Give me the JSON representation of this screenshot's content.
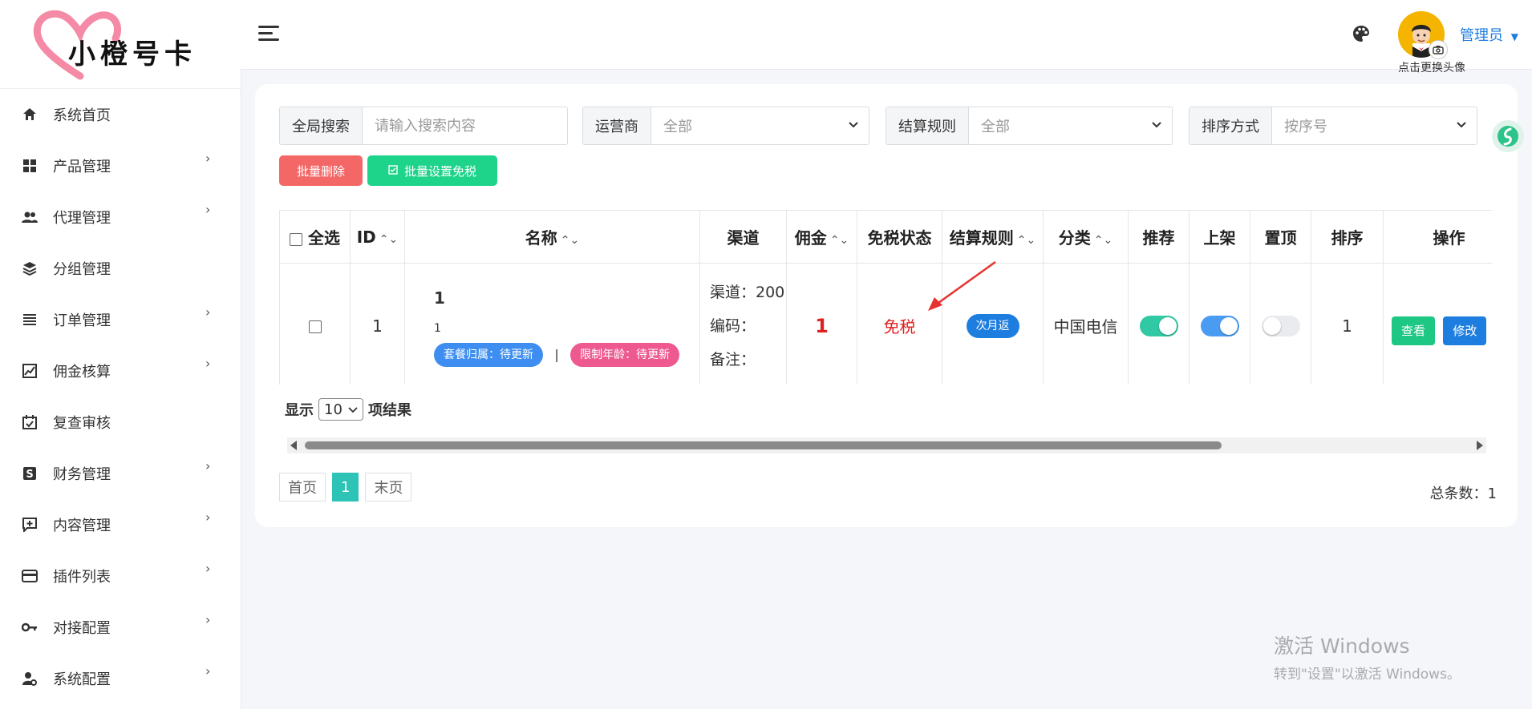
{
  "brand": {
    "logo_text": "小橙号卡"
  },
  "sidebar": {
    "items": [
      {
        "label": "系统首页",
        "icon": "home-icon",
        "has_arrow": false
      },
      {
        "label": "产品管理",
        "icon": "grid-icon",
        "has_arrow": true
      },
      {
        "label": "代理管理",
        "icon": "users-icon",
        "has_arrow": true
      },
      {
        "label": "分组管理",
        "icon": "layers-icon",
        "has_arrow": false
      },
      {
        "label": "订单管理",
        "icon": "list-icon",
        "has_arrow": true
      },
      {
        "label": "佣金核算",
        "icon": "chart-icon",
        "has_arrow": true
      },
      {
        "label": "复查审核",
        "icon": "calendar-check-icon",
        "has_arrow": false
      },
      {
        "label": "财务管理",
        "icon": "dollar-icon",
        "has_arrow": true
      },
      {
        "label": "内容管理",
        "icon": "comment-plus-icon",
        "has_arrow": true
      },
      {
        "label": "插件列表",
        "icon": "card-icon",
        "has_arrow": true
      },
      {
        "label": "对接配置",
        "icon": "key-icon",
        "has_arrow": true
      },
      {
        "label": "系统配置",
        "icon": "user-gear-icon",
        "has_arrow": true
      }
    ]
  },
  "header": {
    "avatar_tip": "点击更换头像",
    "user_name": "管理员"
  },
  "filters": {
    "search": {
      "label": "全局搜索",
      "placeholder": "请输入搜索内容"
    },
    "operator": {
      "label": "运营商",
      "value": "全部"
    },
    "settle": {
      "label": "结算规则",
      "value": "全部"
    },
    "sort": {
      "label": "排序方式",
      "value": "按序号"
    }
  },
  "actions": {
    "batch_delete": "批量删除",
    "batch_tax": "批量设置免税"
  },
  "table": {
    "headers": {
      "select_all": "全选",
      "id": "ID",
      "name": "名称",
      "channel": "渠道",
      "commission": "佣金",
      "tax_status": "免税状态",
      "settle_rule": "结算规则",
      "category": "分类",
      "recommend": "推荐",
      "listed": "上架",
      "pinned": "置顶",
      "order": "排序",
      "operation": "操作"
    },
    "row": {
      "id": "1",
      "name_title": "1",
      "name_sub": "1",
      "tag_package": "套餐归属：待更新",
      "tag_separator": "|",
      "tag_age": "限制年龄：待更新",
      "channel_line1": "渠道：200",
      "channel_line2": "编码：",
      "channel_line3": "备注：",
      "commission": "1",
      "tax_status": "免税",
      "settle_rule": "次月返",
      "category": "中国电信",
      "recommend_on": true,
      "listed_on": true,
      "pinned_on": false,
      "order": "1",
      "btn_view": "查看",
      "btn_edit": "修改"
    }
  },
  "pagination": {
    "show_prefix": "显示",
    "page_size": "10",
    "show_suffix": "项结果",
    "first": "首页",
    "current": "1",
    "last": "末页",
    "total": "总条数：1"
  },
  "watermark": {
    "line1": "激活 Windows",
    "line2": "转到\"设置\"以激活 Windows。"
  },
  "colors": {
    "accent_blue": "#1e7ee0",
    "danger": "#f46767",
    "success": "#1ed38a",
    "teal": "#2ec3b7",
    "tag_blue": "#3d8ef0",
    "tag_pink": "#ee5a8f",
    "tax_red": "#e02020"
  }
}
